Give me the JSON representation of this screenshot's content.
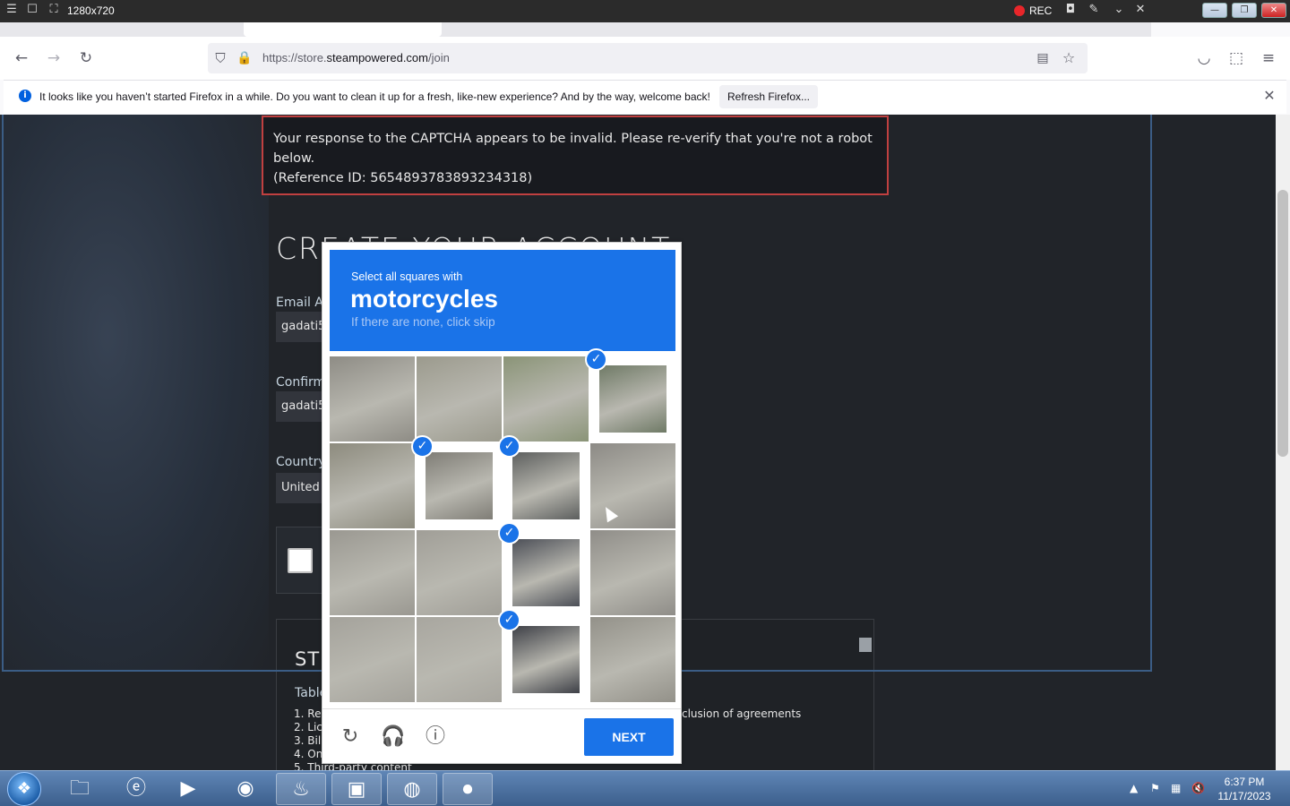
{
  "recorder": {
    "resolution": "1280x720",
    "rec_label": "REC"
  },
  "browser": {
    "url_prefix": "https://store.",
    "url_host": "steampowered.com",
    "url_path": "/join",
    "notification": "It looks like you haven’t started Firefox in a while. Do you want to clean it up for a fresh, like-new experience? And by the way, welcome back!",
    "notification_button": "Refresh Firefox..."
  },
  "page": {
    "error_line1": "Your response to the CAPTCHA appears to be invalid. Please re-verify that you're not a robot",
    "error_line2": "below.",
    "error_ref": "(Reference ID: 5654893783893234318)",
    "title": "CREATE YOUR ACCOUNT",
    "email_label": "Email Ac",
    "email_value": "gadati5",
    "confirm_label": "Confirm",
    "confirm_value": "gadati5",
    "country_label": "Country",
    "country_value": "United",
    "ssa_title": "STE",
    "ssa_sub": "Table",
    "ssa_items": [
      "1. Reg",
      "2. Lice",
      "3. Bill",
      "4. On",
      "5. Third-party content"
    ],
    "ssa_extra": "clusion of agreements"
  },
  "captcha": {
    "instruction": "Select all squares with",
    "target": "motorcycles",
    "hint": "If there are none, click skip",
    "next_label": "NEXT",
    "selected_tiles": [
      3,
      5,
      6,
      10,
      14
    ]
  },
  "taskbar": {
    "time": "6:37 PM",
    "date": "11/17/2023"
  }
}
